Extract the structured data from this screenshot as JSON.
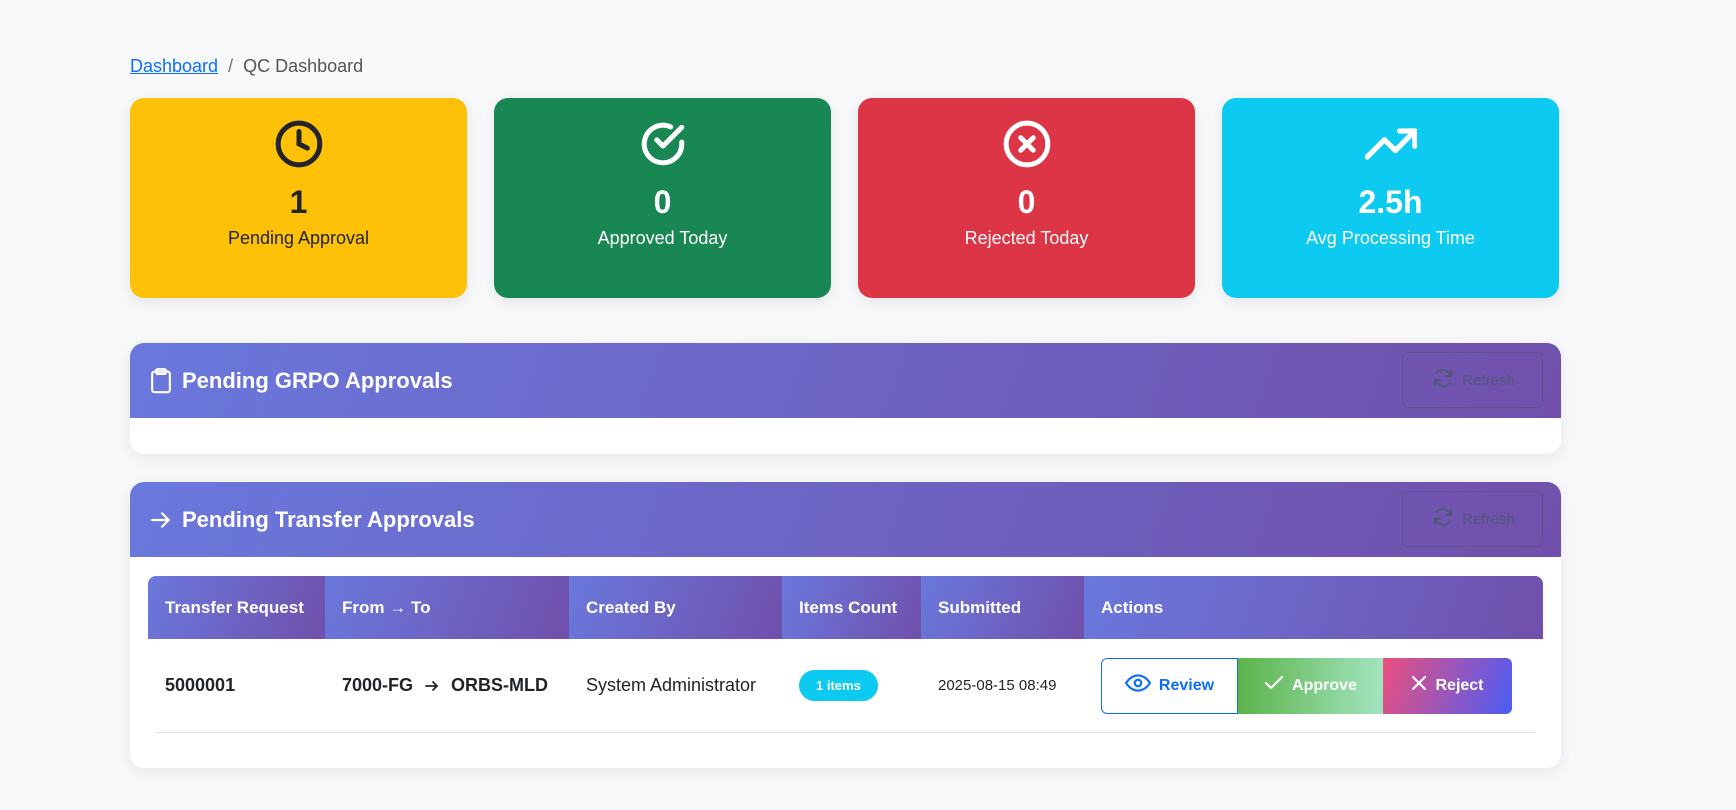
{
  "breadcrumb": {
    "home": "Dashboard",
    "separator": "/",
    "current": "QC Dashboard"
  },
  "stats": [
    {
      "icon": "clock-icon",
      "value": "1",
      "label": "Pending Approval",
      "color": "#ffc107"
    },
    {
      "icon": "check-circle-icon",
      "value": "0",
      "label": "Approved Today",
      "color": "#198754"
    },
    {
      "icon": "x-circle-icon",
      "value": "0",
      "label": "Rejected Today",
      "color": "#dc3545"
    },
    {
      "icon": "trending-up-icon",
      "value": "2.5h",
      "label": "Avg Processing Time",
      "color": "#0dcaf0"
    }
  ],
  "grpo_panel": {
    "icon": "clipboard-icon",
    "title": "Pending GRPO Approvals",
    "refresh_label": "Refresh"
  },
  "transfer_panel": {
    "icon": "arrow-right-icon",
    "title": "Pending Transfer Approvals",
    "refresh_label": "Refresh",
    "columns": [
      "Transfer Request",
      "From → To",
      "Created By",
      "Items Count",
      "Submitted",
      "Actions"
    ],
    "rows": [
      {
        "transfer_request": "5000001",
        "from": "7000-FG",
        "to": "ORBS-MLD",
        "created_by": "System Administrator",
        "items_count": "1 items",
        "submitted": "2025-08-15 08:49",
        "actions": {
          "review": "Review",
          "approve": "Approve",
          "reject": "Reject"
        }
      }
    ]
  },
  "colors": {
    "header_gradient_start": "#6a78dc",
    "header_gradient_end": "#7050ab",
    "link": "#0d6efd",
    "badge": "#0dcaf0"
  }
}
